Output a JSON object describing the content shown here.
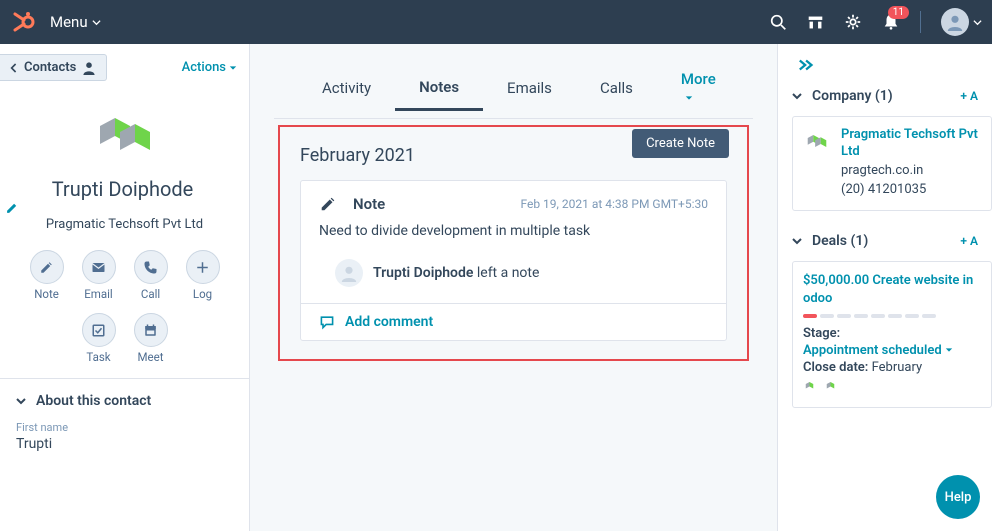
{
  "topbar": {
    "menu_label": "Menu",
    "notif_count": "11"
  },
  "left": {
    "contacts_label": "Contacts",
    "actions_label": "Actions",
    "contact_name": "Trupti Doiphode",
    "contact_company": "Pragmatic Techsoft Pvt Ltd",
    "actions": {
      "note": "Note",
      "email": "Email",
      "call": "Call",
      "log": "Log",
      "task": "Task",
      "meet": "Meet"
    },
    "about_title": "About this contact",
    "first_name_label": "First name",
    "first_name_value": "Trupti"
  },
  "center": {
    "tabs": {
      "activity": "Activity",
      "notes": "Notes",
      "emails": "Emails",
      "calls": "Calls",
      "more": "More"
    },
    "create_note": "Create Note",
    "month": "February 2021",
    "note": {
      "title": "Note",
      "date": "Feb 19, 2021 at 4:38 PM GMT+5:30",
      "body": "Need to divide development in multiple task",
      "author_name": "Trupti Doiphode",
      "author_action": " left a note"
    },
    "add_comment": "Add comment"
  },
  "right": {
    "company_section": "Company (1)",
    "company_add": "+ A",
    "company_name": "Pragmatic Techsoft Pvt Ltd",
    "company_domain": "pragtech.co.in",
    "company_phone": "(20) 41201035",
    "deals_section": "Deals (1)",
    "deals_add": "+ A",
    "deal_title": "$50,000.00 Create website in odoo",
    "stage_label": "Stage:",
    "stage_value": "Appointment scheduled",
    "close_label": "Close date:",
    "close_value": "February"
  },
  "help": "Help"
}
